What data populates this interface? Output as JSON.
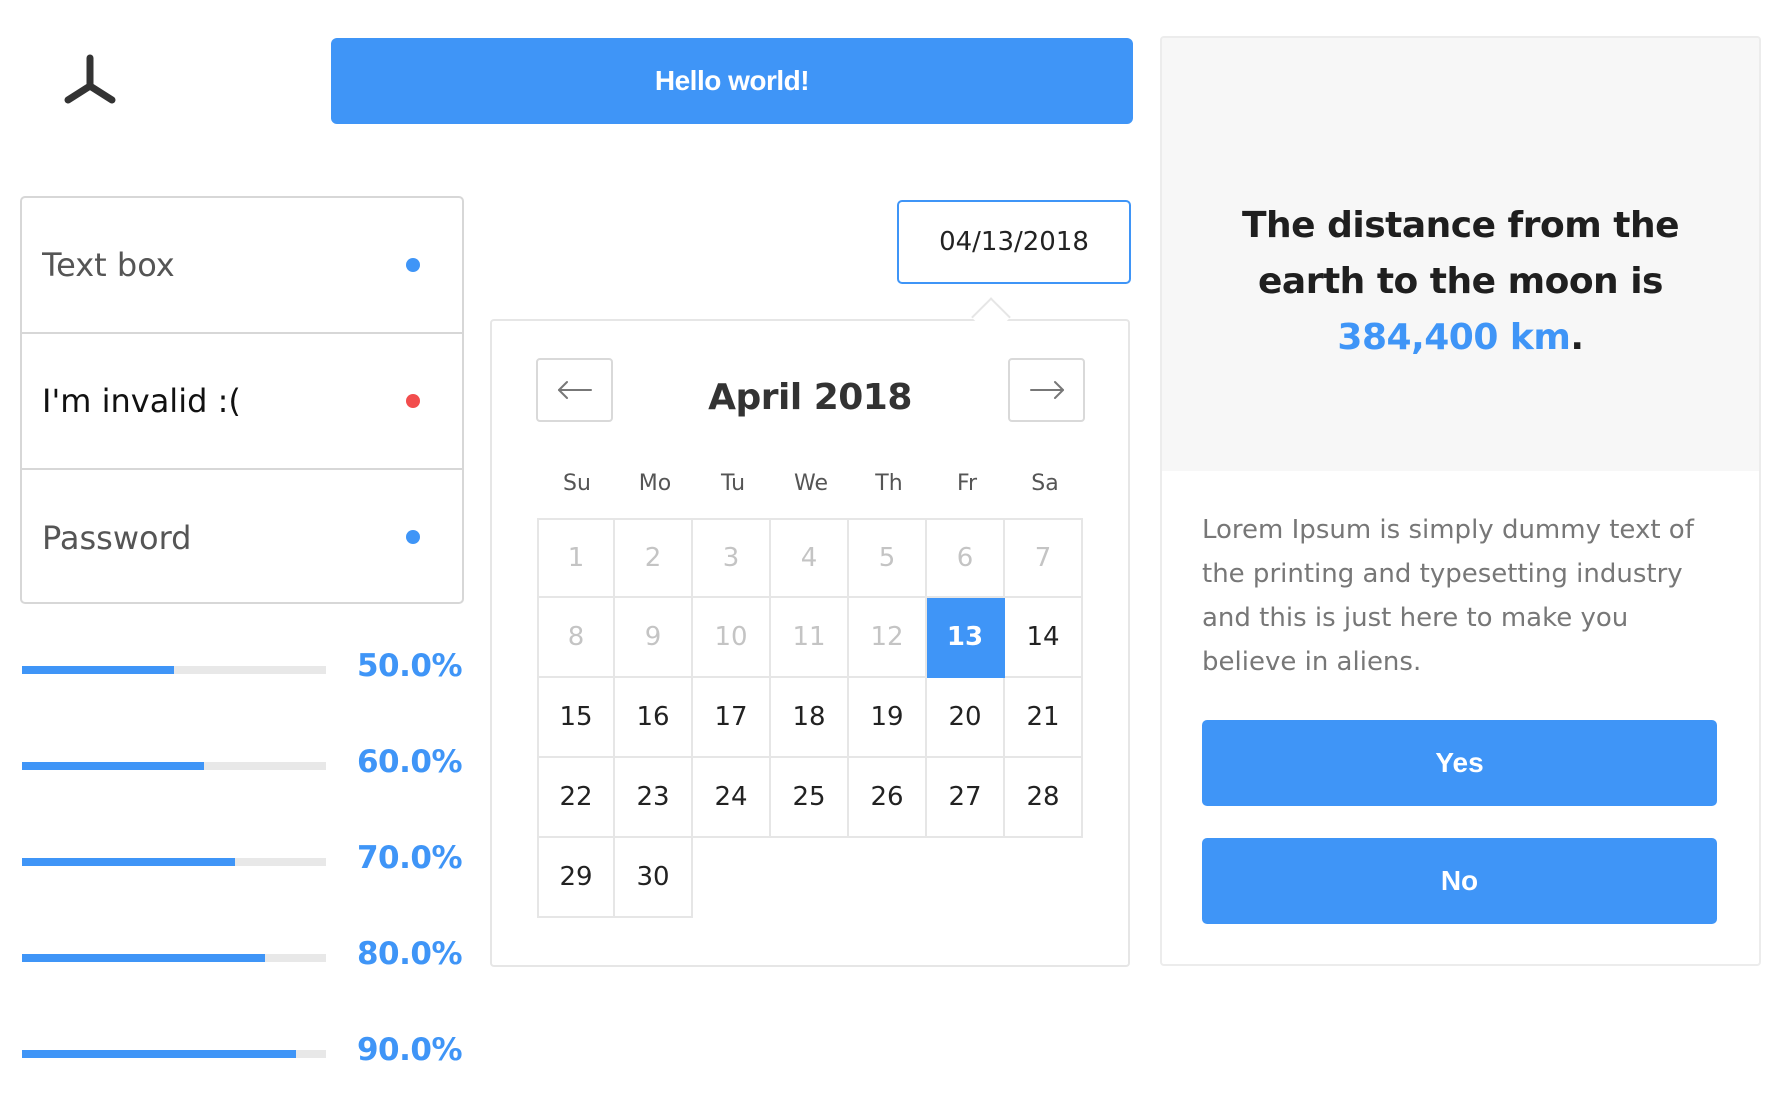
{
  "header": {
    "logo_icon": "tri-spoke-logo-icon",
    "hello_button_label": "Hello world!"
  },
  "form": {
    "fields": [
      {
        "placeholder": "Text box",
        "value": "",
        "status_color": "#3f95f7"
      },
      {
        "placeholder": "",
        "value": "I'm invalid :(",
        "status_color": "#f24d4d"
      },
      {
        "placeholder": "Password",
        "value": "",
        "status_color": "#3f95f7"
      }
    ]
  },
  "progress": [
    {
      "label": "50.0%",
      "value": 0.5
    },
    {
      "label": "60.0%",
      "value": 0.6
    },
    {
      "label": "70.0%",
      "value": 0.7
    },
    {
      "label": "80.0%",
      "value": 0.8
    },
    {
      "label": "90.0%",
      "value": 0.9
    }
  ],
  "datepicker": {
    "value": "04/13/2018",
    "month_title": "April 2018",
    "prev_icon": "arrow-left-icon",
    "next_icon": "arrow-right-icon",
    "weekdays": [
      "Su",
      "Mo",
      "Tu",
      "We",
      "Th",
      "Fr",
      "Sa"
    ],
    "days": [
      1,
      2,
      3,
      4,
      5,
      6,
      7,
      8,
      9,
      10,
      11,
      12,
      13,
      14,
      15,
      16,
      17,
      18,
      19,
      20,
      21,
      22,
      23,
      24,
      25,
      26,
      27,
      28,
      29,
      30
    ],
    "selected_day": 13,
    "first_weekday_index": 0
  },
  "card": {
    "headline_prefix": "The distance from the earth to the moon is ",
    "headline_highlight": "384,400 km",
    "headline_suffix": ".",
    "body": "Lorem Ipsum is simply dummy text of the printing and typesetting industry and this is just here to make you believe in aliens.",
    "yes_label": "Yes",
    "no_label": "No"
  },
  "colors": {
    "accent": "#3f95f7",
    "error": "#f24d4d"
  }
}
